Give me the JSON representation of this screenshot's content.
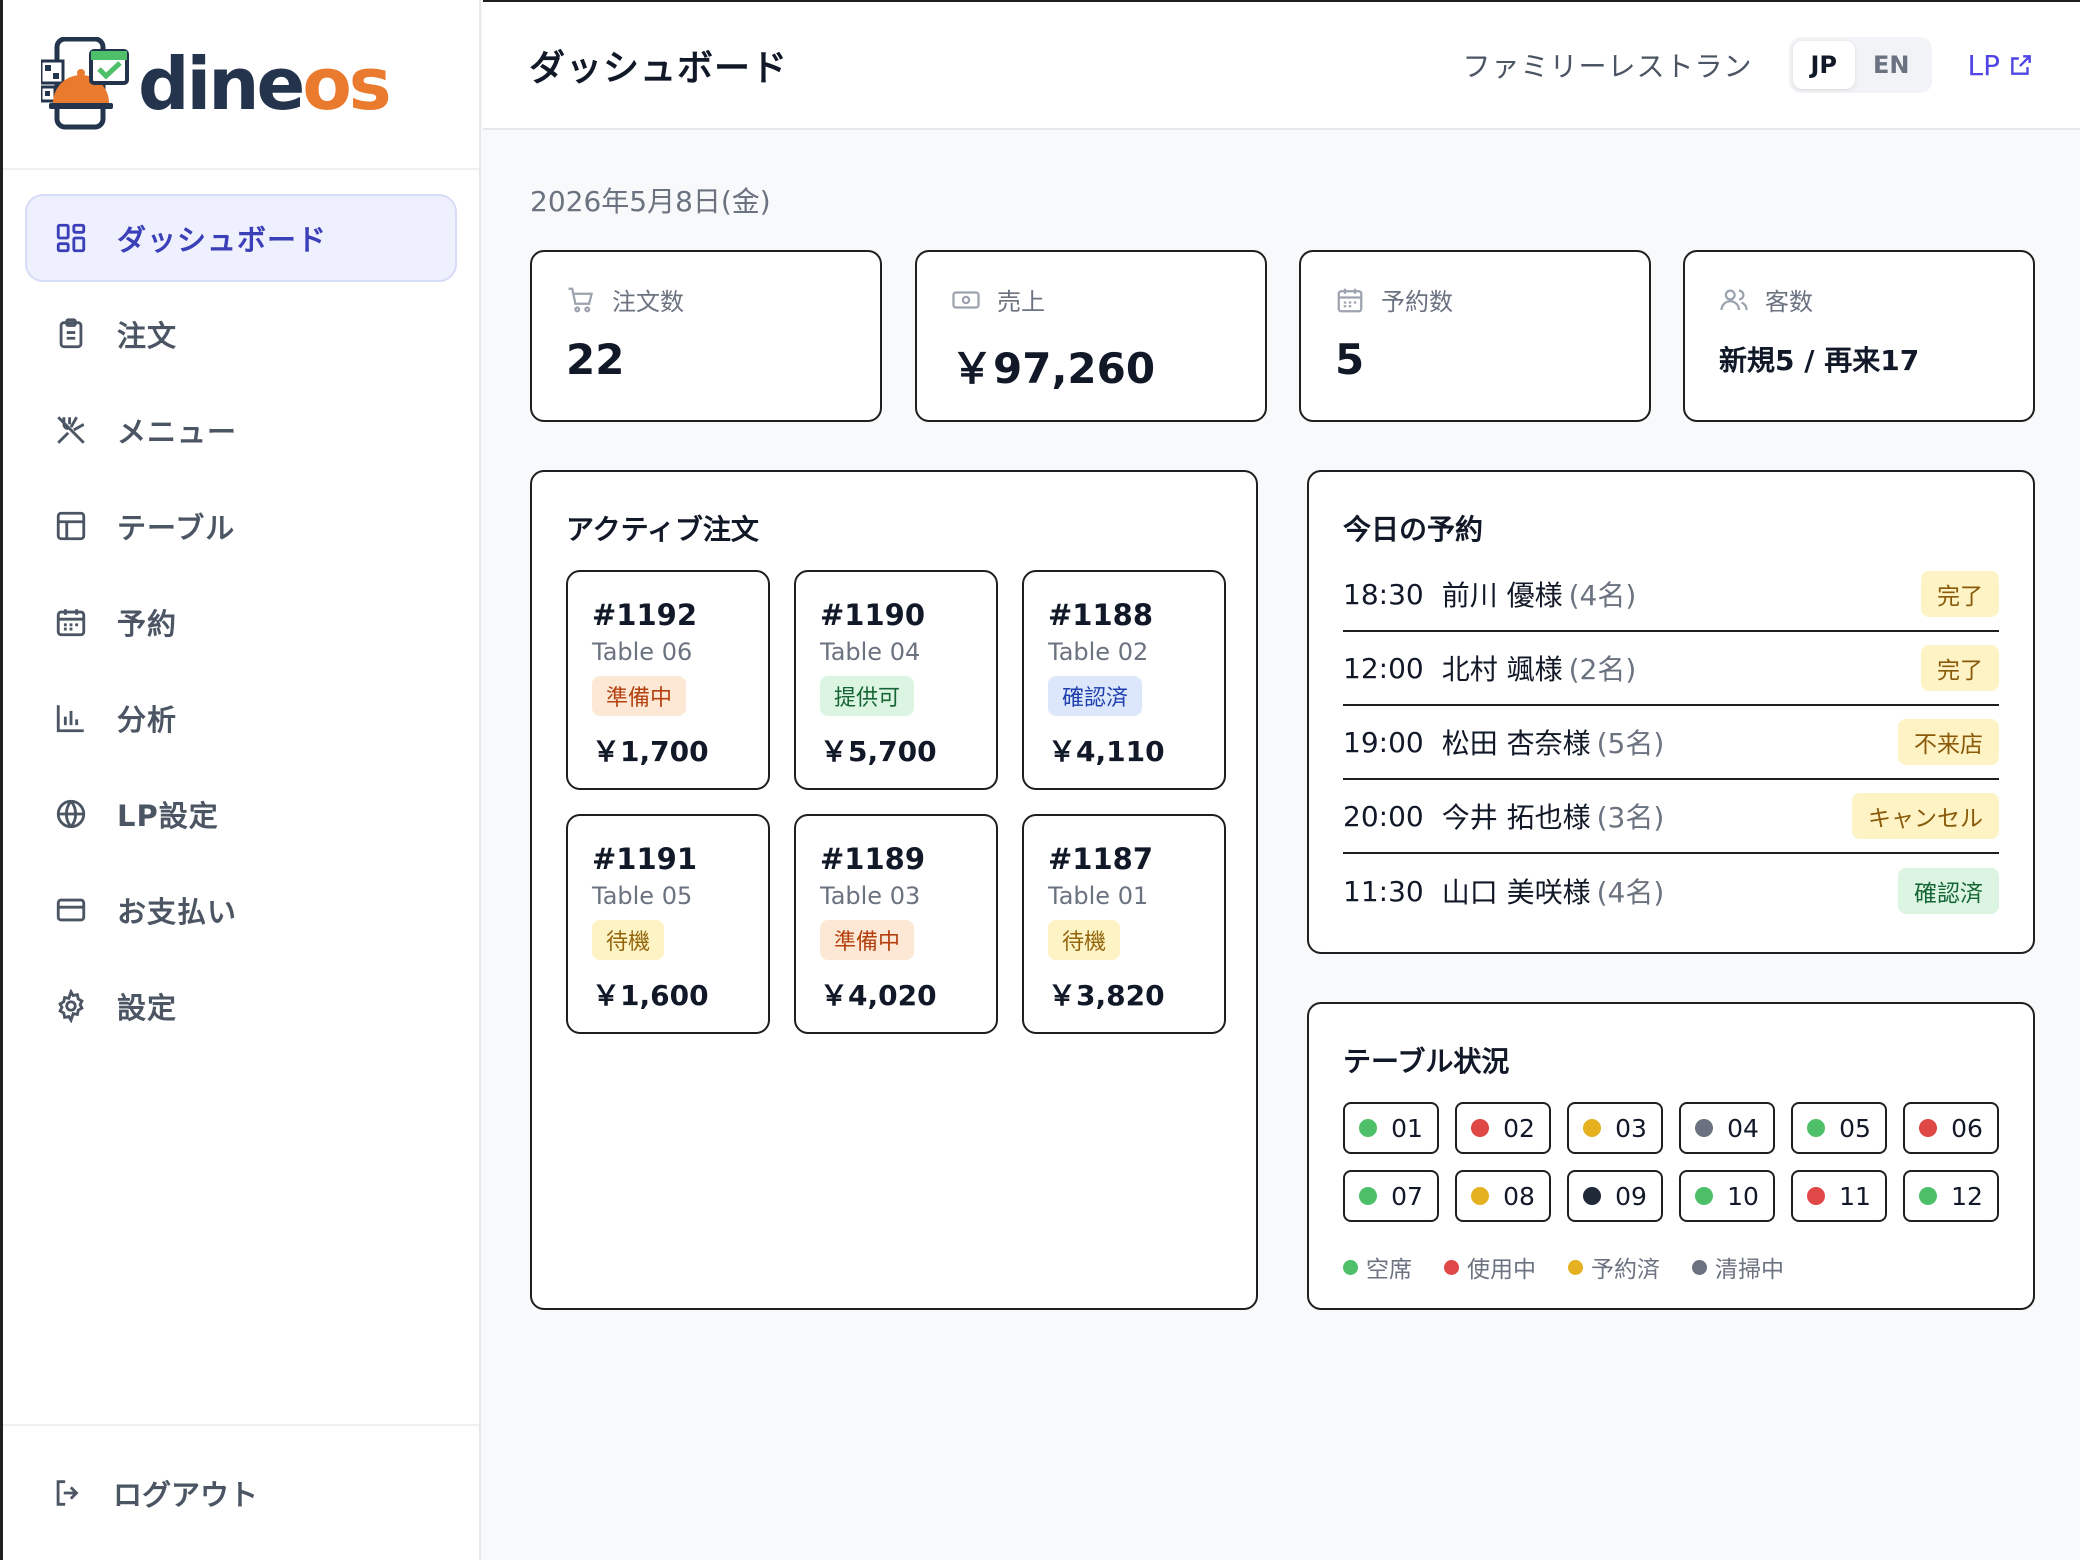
{
  "brand": {
    "name_part1": "dine",
    "name_part2": "os"
  },
  "sidebar": {
    "items": [
      {
        "label": "ダッシュボード",
        "icon": "dashboard-grid-icon",
        "active": true
      },
      {
        "label": "注文",
        "icon": "clipboard-icon"
      },
      {
        "label": "メニュー",
        "icon": "utensils-icon"
      },
      {
        "label": "テーブル",
        "icon": "table-layout-icon"
      },
      {
        "label": "予約",
        "icon": "calendar-icon"
      },
      {
        "label": "分析",
        "icon": "bar-chart-icon"
      },
      {
        "label": "LP設定",
        "icon": "globe-icon"
      },
      {
        "label": "お支払い",
        "icon": "credit-card-icon"
      },
      {
        "label": "設定",
        "icon": "gear-icon"
      }
    ],
    "logout": "ログアウト"
  },
  "header": {
    "title": "ダッシュボード",
    "shop_name": "ファミリーレストラン",
    "lang_jp": "JP",
    "lang_en": "EN",
    "lp_link": "LP"
  },
  "date": "2026年5月8日(金)",
  "stats": [
    {
      "label": "注文数",
      "value": "22",
      "icon": "cart-icon"
    },
    {
      "label": "売上",
      "value": "￥97,260",
      "icon": "cash-icon"
    },
    {
      "label": "予約数",
      "value": "5",
      "icon": "calendar-icon"
    },
    {
      "label": "客数",
      "value": "新規5 / 再来17",
      "icon": "users-icon"
    }
  ],
  "orders": {
    "title": "アクティブ注文",
    "items": [
      {
        "num": "#1192",
        "table": "Table 06",
        "status": "準備中",
        "price": "￥1,700"
      },
      {
        "num": "#1190",
        "table": "Table 04",
        "status": "提供可",
        "price": "￥5,700"
      },
      {
        "num": "#1188",
        "table": "Table 02",
        "status": "確認済",
        "price": "￥4,110"
      },
      {
        "num": "#1191",
        "table": "Table 05",
        "status": "待機",
        "price": "￥1,600"
      },
      {
        "num": "#1189",
        "table": "Table 03",
        "status": "準備中",
        "price": "￥4,020"
      },
      {
        "num": "#1187",
        "table": "Table 01",
        "status": "待機",
        "price": "￥3,820"
      }
    ]
  },
  "reservations": {
    "title": "今日の予約",
    "items": [
      {
        "time": "18:30",
        "name": "前川 優様",
        "people": "(4名)",
        "status": "完了"
      },
      {
        "time": "12:00",
        "name": "北村 颯様",
        "people": "(2名)",
        "status": "完了"
      },
      {
        "time": "19:00",
        "name": "松田 杏奈様",
        "people": "(5名)",
        "status": "不来店"
      },
      {
        "time": "20:00",
        "name": "今井 拓也様",
        "people": "(3名)",
        "status": "キャンセル"
      },
      {
        "time": "11:30",
        "name": "山口 美咲様",
        "people": "(4名)",
        "status": "確認済"
      }
    ]
  },
  "tables": {
    "title": "テーブル状況",
    "items": [
      {
        "id": "01",
        "state": "free"
      },
      {
        "id": "02",
        "state": "busy"
      },
      {
        "id": "03",
        "state": "reserved"
      },
      {
        "id": "04",
        "state": "cleaning"
      },
      {
        "id": "05",
        "state": "free"
      },
      {
        "id": "06",
        "state": "busy"
      },
      {
        "id": "07",
        "state": "free"
      },
      {
        "id": "08",
        "state": "reserved"
      },
      {
        "id": "09",
        "state": "dark"
      },
      {
        "id": "10",
        "state": "free"
      },
      {
        "id": "11",
        "state": "busy"
      },
      {
        "id": "12",
        "state": "free"
      }
    ],
    "legend": {
      "free": "空席",
      "busy": "使用中",
      "reserved": "予約済",
      "cleaning": "清掃中"
    }
  },
  "colors": {
    "accent": "#4f46e5",
    "free": "#4ec06a",
    "busy": "#e04848",
    "reserved": "#e6b120",
    "cleaning": "#6b7280",
    "dark": "#1f2937"
  }
}
